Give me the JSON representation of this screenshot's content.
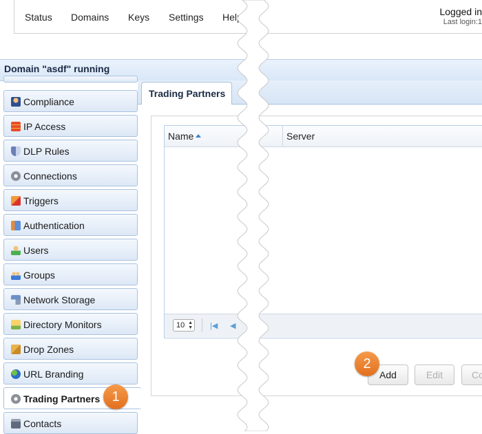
{
  "nav": {
    "items": [
      "Status",
      "Domains",
      "Keys",
      "Settings",
      "Help"
    ],
    "logged_in": "Logged in",
    "last_login": "Last login:1"
  },
  "domain_title": "Domain \"asdf\" running",
  "sidebar": {
    "items": [
      {
        "label": "Compliance",
        "icon": "compliance-icon"
      },
      {
        "label": "IP Access",
        "icon": "ip-access-icon"
      },
      {
        "label": "DLP Rules",
        "icon": "shield-icon"
      },
      {
        "label": "Connections",
        "icon": "gear-icon"
      },
      {
        "label": "Triggers",
        "icon": "trigger-icon"
      },
      {
        "label": "Authentication",
        "icon": "id-card-icon"
      },
      {
        "label": "Users",
        "icon": "user-icon"
      },
      {
        "label": "Groups",
        "icon": "group-icon"
      },
      {
        "label": "Network Storage",
        "icon": "network-storage-icon"
      },
      {
        "label": "Directory Monitors",
        "icon": "directory-monitor-icon"
      },
      {
        "label": "Drop Zones",
        "icon": "box-icon"
      },
      {
        "label": "URL Branding",
        "icon": "globe-icon"
      },
      {
        "label": "Trading Partners",
        "icon": "gear-icon"
      },
      {
        "label": "Contacts",
        "icon": "contacts-icon"
      }
    ],
    "active": "Trading Partners"
  },
  "tab": {
    "label": "Trading Partners"
  },
  "grid": {
    "columns": [
      "Name",
      "Server"
    ],
    "sort_column": "Name",
    "page_size": "10"
  },
  "buttons": {
    "add": "Add",
    "edit": "Edit",
    "copy": "Co"
  },
  "badges": {
    "one": "1",
    "two": "2"
  },
  "colors": {
    "accent": "#3b7fd1",
    "badge": "#e9782a"
  }
}
